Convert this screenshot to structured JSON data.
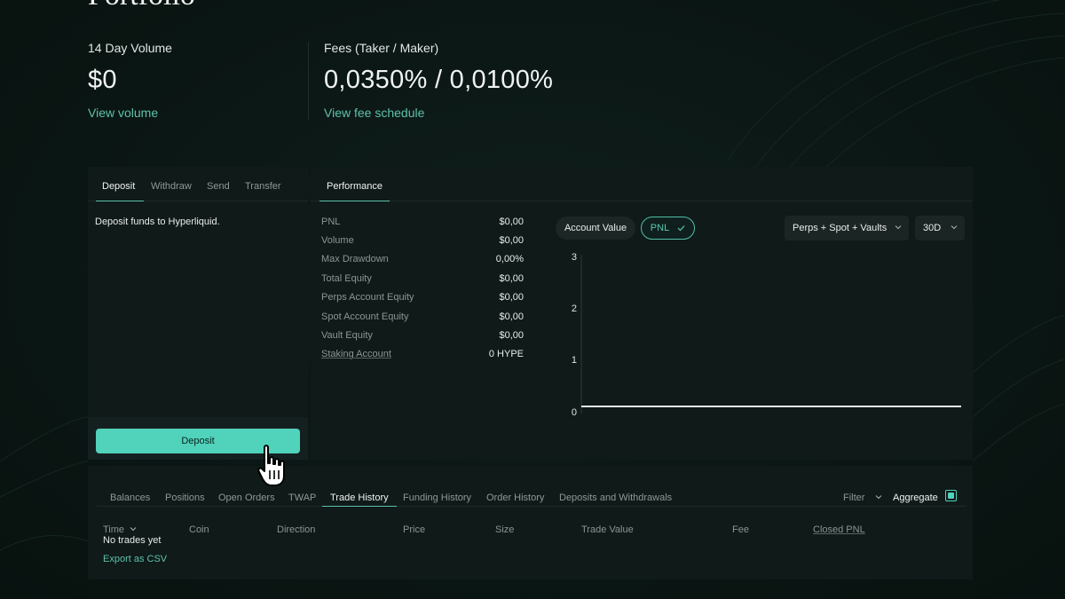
{
  "page": {
    "title": "Portfolio"
  },
  "stats": {
    "volume": {
      "label": "14 Day Volume",
      "value": "$0",
      "link": "View volume"
    },
    "fees": {
      "label": "Fees (Taker / Maker)",
      "value": "0,0350% / 0,0100%",
      "link": "View fee schedule"
    }
  },
  "transfer_panel": {
    "tabs": [
      "Deposit",
      "Withdraw",
      "Send",
      "Transfer"
    ],
    "active_tab": "Deposit",
    "description": "Deposit funds to Hyperliquid.",
    "button_label": "Deposit"
  },
  "performance": {
    "tab": "Performance",
    "metrics": [
      {
        "label": "PNL",
        "value": "$0,00"
      },
      {
        "label": "Volume",
        "value": "$0,00"
      },
      {
        "label": "Max Drawdown",
        "value": "0,00%"
      },
      {
        "label": "Total Equity",
        "value": "$0,00"
      },
      {
        "label": "Perps Account Equity",
        "value": "$0,00"
      },
      {
        "label": "Spot Account Equity",
        "value": "$0,00"
      },
      {
        "label": "Vault Equity",
        "value": "$0,00"
      },
      {
        "label": "Staking Account",
        "value": "0 HYPE"
      }
    ],
    "toggle": {
      "account_value": "Account Value",
      "pnl": "PNL",
      "selected": "PNL"
    },
    "scope_select": "Perps + Spot + Vaults",
    "range_select": "30D"
  },
  "chart_data": {
    "type": "line",
    "series": [
      {
        "values": [
          0,
          0
        ]
      }
    ],
    "yticks": [
      "3",
      "2",
      "1",
      "0"
    ],
    "ylim": [
      0,
      3
    ],
    "grid": false
  },
  "history": {
    "tabs": [
      "Balances",
      "Positions",
      "Open Orders",
      "TWAP",
      "Trade History",
      "Funding History",
      "Order History",
      "Deposits and Withdrawals"
    ],
    "active_tab": "Trade History",
    "filter_label": "Filter",
    "aggregate_label": "Aggregate",
    "aggregate_checked": true,
    "columns": [
      "Time",
      "Coin",
      "Direction",
      "Price",
      "Size",
      "Trade Value",
      "Fee",
      "Closed PNL"
    ],
    "empty_message": "No trades yet",
    "export_label": "Export as CSV"
  },
  "colors": {
    "accent": "#50d2bb",
    "link": "#5fc1ab",
    "background": "#0b1715",
    "panel": "#0f1a19"
  }
}
